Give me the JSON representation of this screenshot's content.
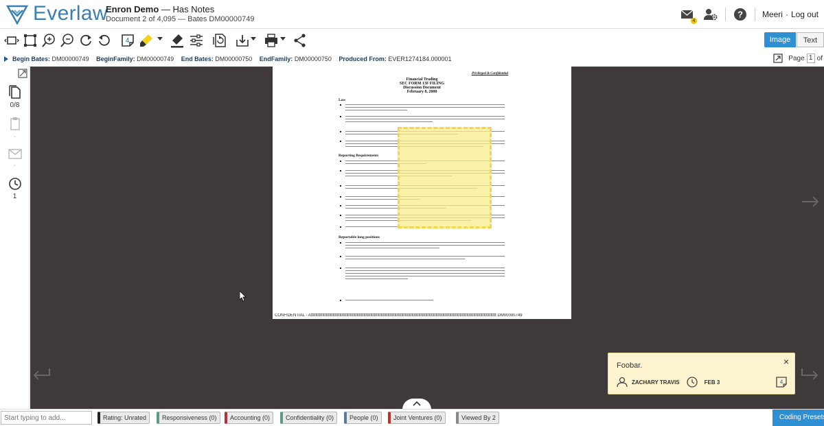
{
  "header": {
    "brand": "Everlaw",
    "project": "Enron Demo",
    "project_sep": " — ",
    "project_note": "Has Notes",
    "doc_position": "Document 2 of 4,095 — Bates DM00000749",
    "messages_badge": "4",
    "user": "Meeri",
    "user_sep": "·",
    "logout": "Log out",
    "icons": [
      "mail-icon",
      "admin-gear-icon",
      "help-icon"
    ]
  },
  "toolbar": {
    "tools": [
      "view-fit-icon",
      "crop-icon",
      "zoom-in-icon",
      "zoom-out-icon",
      "rotate-cw-icon",
      "rotate-ccw-icon",
      "note-icon",
      "highlighter-icon",
      "redact-icon",
      "settings-sliders-icon",
      "copy-doc-icon",
      "download-icon",
      "print-icon",
      "share-icon"
    ],
    "note_count": "4",
    "image_label": "Image",
    "text_label": "Text",
    "accent": "#2f8fd3",
    "highlighter_color": "#f2d21a"
  },
  "meta": {
    "fields": [
      {
        "label": "Begin Bates:",
        "value": "DM00000749"
      },
      {
        "label": "BeginFamily:",
        "value": "DM00000749"
      },
      {
        "label": "End Bates:",
        "value": "DM00000750"
      },
      {
        "label": "EndFamily:",
        "value": "DM00000750"
      },
      {
        "label": "Produced From:",
        "value": "EVER1274184.000001"
      }
    ],
    "page_label": "Page",
    "page_value": "1",
    "page_of": "of"
  },
  "sidebar": {
    "pages_count": "0/8",
    "dash1": "-",
    "dash2": "-",
    "history_count": "1"
  },
  "document": {
    "privileged": "Privileged & Confidential",
    "title_lines": [
      "Financial Trading",
      "SEC FORM 13F FILING",
      "Discussion Document",
      "February 8, 2000"
    ],
    "section_law": "Law",
    "section_reporting": "Reporting Requirements",
    "section_positions": "Reportable long positions",
    "footer": "CONFIDENTIAL - Atttttttttttttttttttttttttttttttttttttttttttttttttttttttttttttttttttttttttttttttttttttttttttttttttttttttttttttttttttttttttttttttttttttttttttttttttttttttttttttttttt DM00000749"
  },
  "note": {
    "text": "Foobar.",
    "author": "ZACHARY TRAVIS",
    "date": "FEB 3",
    "close": "×",
    "count": "4"
  },
  "tagbar": {
    "placeholder": "Start typing to add...",
    "tags": [
      {
        "label": "Rating: Unrated",
        "color": "#222222"
      },
      {
        "label": "Responsiveness (0)",
        "color": "#5a9a8a"
      },
      {
        "label": "Accounting (0)",
        "color": "#b03040"
      },
      {
        "label": "Confidentiality (0)",
        "color": "#5a9a8a"
      },
      {
        "label": "People (0)",
        "color": "#5a7a9a"
      },
      {
        "label": "Joint Ventures (0)",
        "color": "#c0302a"
      },
      {
        "label": "Viewed By 2",
        "color": "#888888"
      }
    ],
    "coding_presets": "Coding Presets"
  }
}
